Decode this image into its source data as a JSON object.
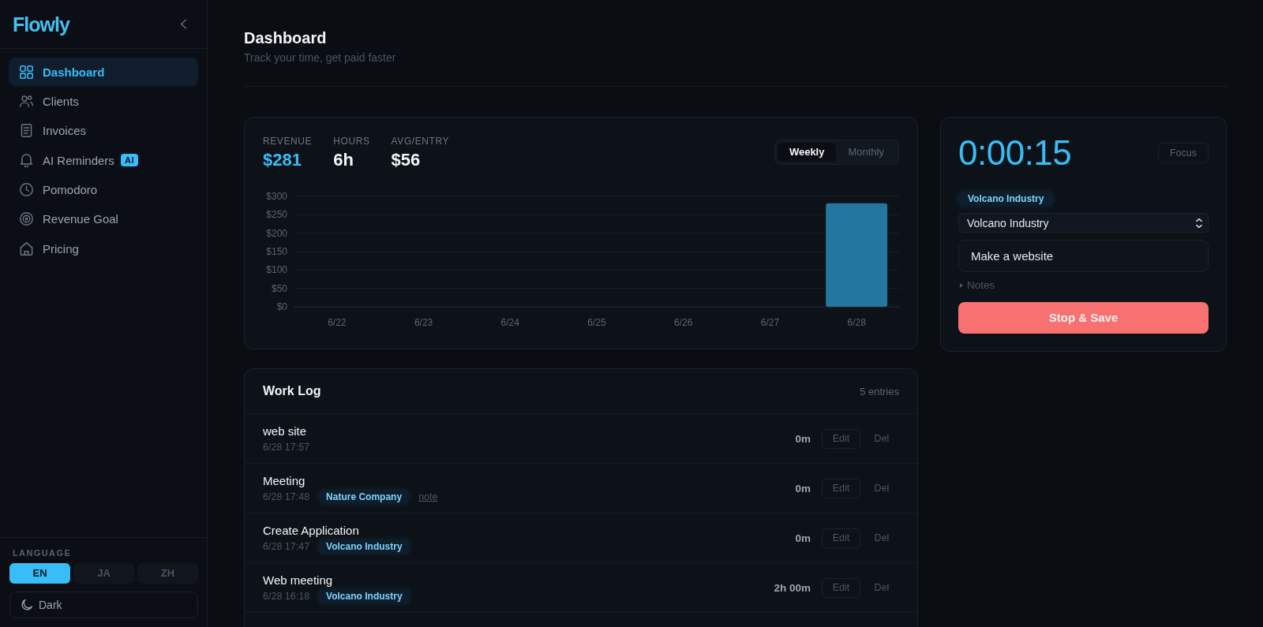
{
  "sidebar": {
    "logo": "Flowly",
    "nav": [
      {
        "label": "Dashboard",
        "selected": true
      },
      {
        "label": "Clients",
        "selected": false
      },
      {
        "label": "Invoices",
        "selected": false
      },
      {
        "label": "AI Reminders",
        "badge": "AI",
        "selected": false
      },
      {
        "label": "Pomodoro",
        "selected": false
      },
      {
        "label": "Revenue Goal",
        "selected": false
      },
      {
        "label": "Pricing",
        "selected": false
      }
    ],
    "language": {
      "label": "LANGUAGE",
      "options": [
        {
          "label": "EN",
          "selected": true
        },
        {
          "label": "JA",
          "selected": false
        },
        {
          "label": "ZH",
          "selected": false
        }
      ]
    },
    "theme_button": "Dark"
  },
  "header": {
    "title": "Dashboard",
    "subtitle": "Track your time, get paid faster"
  },
  "summary": {
    "stats": [
      {
        "label": "REVENUE",
        "value": "$281"
      },
      {
        "label": "HOURS",
        "value": "6h"
      },
      {
        "label": "AVG/ENTRY",
        "value": "$56"
      }
    ],
    "period_toggle": [
      {
        "label": "Weekly",
        "selected": true
      },
      {
        "label": "Monthly",
        "selected": false
      }
    ],
    "chart_data": {
      "type": "bar",
      "categories": [
        "6/22",
        "6/23",
        "6/24",
        "6/25",
        "6/26",
        "6/27",
        "6/28"
      ],
      "values": [
        0,
        0,
        0,
        0,
        0,
        0,
        281
      ],
      "ylim": [
        0,
        300
      ],
      "yticks": [
        {
          "value": 0,
          "label": "$0"
        },
        {
          "value": 50,
          "label": "$50"
        },
        {
          "value": 100,
          "label": "$100"
        },
        {
          "value": 150,
          "label": "$150"
        },
        {
          "value": 200,
          "label": "$200"
        },
        {
          "value": 250,
          "label": "$250"
        },
        {
          "value": 300,
          "label": "$300"
        }
      ],
      "grid": true
    }
  },
  "timer": {
    "time": "0:00:15",
    "focus_button": "Focus",
    "client_tag": "Volcano Industry",
    "client_select": "Volcano Industry",
    "task": {
      "value": "Make a website"
    },
    "notes": {
      "label": "Notes",
      "expanded": false
    },
    "stop_button": "Stop & Save"
  },
  "work_log": {
    "title": "Work Log",
    "count": "5 entries",
    "entries": [
      {
        "title": "web site",
        "time": "6/28 17:57",
        "duration": "0m",
        "actions": {
          "edit": "Edit",
          "delete": "Del"
        }
      },
      {
        "title": "Meeting",
        "time": "6/28 17:48",
        "client": "Nature Company",
        "note": "note",
        "duration": "0m",
        "actions": {
          "edit": "Edit",
          "delete": "Del"
        }
      },
      {
        "title": "Create Application",
        "time": "6/28 17:47",
        "client": "Volcano Industry",
        "duration": "0m",
        "actions": {
          "edit": "Edit",
          "delete": "Del"
        }
      },
      {
        "title": "Web meeting",
        "time": "6/28 16:18",
        "client": "Volcano Industry",
        "duration": "2h 00m",
        "actions": {
          "edit": "Edit",
          "delete": "Del"
        }
      }
    ]
  }
}
